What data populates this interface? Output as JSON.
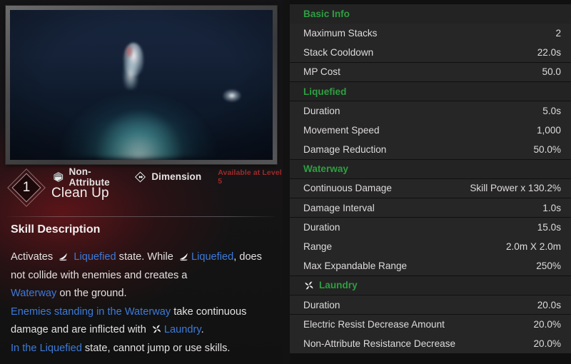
{
  "skill": {
    "level": "1",
    "name": "Clean Up",
    "attribute_tag": "Non-Attribute",
    "type_tag": "Dimension",
    "availability": "Available at Level 5",
    "attribute_icon": "non-attribute-icon",
    "type_icon": "dimension-icon"
  },
  "description": {
    "title": "Skill Description",
    "line1_a": "Activates",
    "line1_hl1": "Liquefied",
    "line1_b": "state. While",
    "line1_hl2": "Liquefied",
    "line1_c": ", does not collide with enemies and creates a",
    "line2_hl": "Waterway",
    "line2_b": "on the ground.",
    "line3_hl": "Enemies standing in the Waterway",
    "line3_b": "take continuous damage and are inflicted with",
    "line3_hl2": "Laundry",
    "line3_c": ".",
    "line4_hl": "In the Liquefied",
    "line4_b": "state, cannot jump or use skills."
  },
  "stats": [
    {
      "kind": "section",
      "label": "Basic Info",
      "icon": null
    },
    {
      "kind": "row",
      "key": "Maximum Stacks",
      "value": "2"
    },
    {
      "kind": "row",
      "key": "Stack Cooldown",
      "value": "22.0s"
    },
    {
      "kind": "row",
      "key": "MP Cost",
      "value": "50.0"
    },
    {
      "kind": "section",
      "label": "Liquefied",
      "icon": null
    },
    {
      "kind": "row",
      "key": "Duration",
      "value": "5.0s"
    },
    {
      "kind": "row",
      "key": "Movement Speed",
      "value": "1,000"
    },
    {
      "kind": "row",
      "key": "Damage Reduction",
      "value": "50.0%"
    },
    {
      "kind": "section",
      "label": "Waterway",
      "icon": null
    },
    {
      "kind": "row",
      "key": "Continuous Damage",
      "value": "Skill Power x 130.2%"
    },
    {
      "kind": "row",
      "key": "Damage Interval",
      "value": "1.0s"
    },
    {
      "kind": "row",
      "key": "Duration",
      "value": "15.0s"
    },
    {
      "kind": "row",
      "key": "Range",
      "value": "2.0m X 2.0m"
    },
    {
      "kind": "row",
      "key": "Max Expandable Range",
      "value": "250%"
    },
    {
      "kind": "section",
      "label": "Laundry",
      "icon": "laundry-icon"
    },
    {
      "kind": "row",
      "key": "Duration",
      "value": "20.0s"
    },
    {
      "kind": "row",
      "key": "Electric Resist Decrease Amount",
      "value": "20.0%"
    },
    {
      "kind": "row",
      "key": "Non-Attribute Resistance Decrease",
      "value": "20.0%"
    }
  ],
  "colors": {
    "section_green": "#2f9e41",
    "link_blue": "#3d7ad8",
    "availability_red": "#9e2a2a",
    "row_bg": "#262626",
    "panel_bg": "#101010"
  }
}
